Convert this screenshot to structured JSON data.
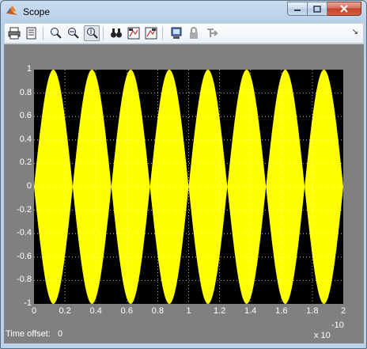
{
  "window": {
    "title": "Scope"
  },
  "toolbar": {
    "buttons": [
      {
        "name": "print-icon"
      },
      {
        "name": "parameters-icon"
      },
      {
        "name": "zoom-icon"
      },
      {
        "name": "zoom-x-icon"
      },
      {
        "name": "zoom-y-icon",
        "pressed": true
      },
      {
        "name": "autoscale-icon"
      },
      {
        "name": "save-axes-icon"
      },
      {
        "name": "restore-axes-icon"
      },
      {
        "name": "floating-scope-icon"
      },
      {
        "name": "lock-axes-icon"
      },
      {
        "name": "signal-selector-icon"
      }
    ],
    "menu_arrow": "↘"
  },
  "footer": {
    "time_offset_label": "Time offset:",
    "time_offset_value": "0",
    "x_exponent_base": "x 10",
    "x_exponent_power": "-10"
  },
  "colors": {
    "signal": "#ffff00",
    "plot_bg": "#000000",
    "frame_bg": "#808080",
    "grid": "#ffffff"
  },
  "chart_data": {
    "type": "line",
    "title": "",
    "xlabel": "",
    "ylabel": "",
    "xlim": [
      0,
      2
    ],
    "ylim": [
      -1,
      1
    ],
    "x_scale_note": "x 10^-10",
    "xticks": [
      "0",
      "0.2",
      "0.4",
      "0.6",
      "0.8",
      "1",
      "1.2",
      "1.4",
      "1.6",
      "1.8",
      "2"
    ],
    "yticks": [
      "1",
      "0.8",
      "0.6",
      "0.4",
      "0.2",
      "0",
      "-0.2",
      "-0.4",
      "-0.6",
      "-0.8",
      "-1"
    ],
    "grid": true,
    "series": [
      {
        "envelope_peaks_x": [
          0.125,
          0.375,
          0.625,
          0.875,
          1.125,
          1.375,
          1.625,
          1.875
        ],
        "envelope_nodes_x": [
          0,
          0.25,
          0.5,
          0.75,
          1.0,
          1.25,
          1.5,
          1.75,
          2.0
        ],
        "amplitude": 1
      }
    ]
  }
}
